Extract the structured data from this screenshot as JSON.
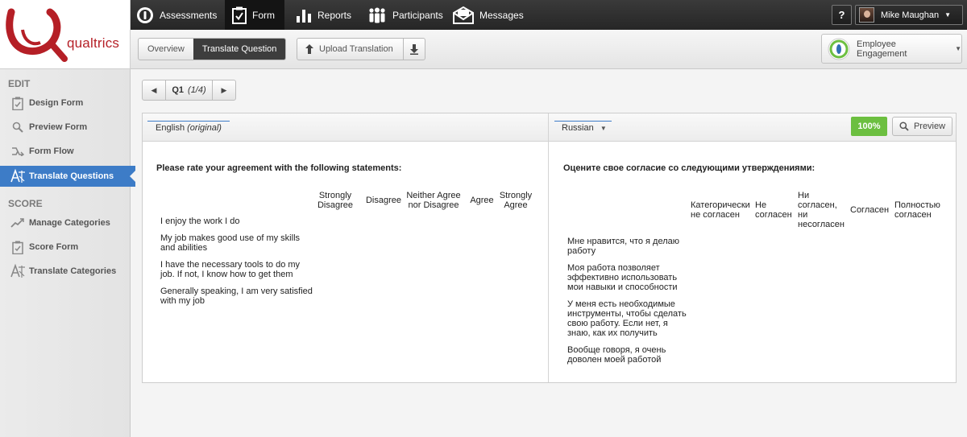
{
  "brand": {
    "logo_text": "qualtrics",
    "color": "#b51f26"
  },
  "topnav": {
    "items": [
      {
        "label": "Assessments",
        "icon": "assessments-icon"
      },
      {
        "label": "Form",
        "icon": "form-icon",
        "active": true
      },
      {
        "label": "Reports",
        "icon": "reports-icon"
      },
      {
        "label": "Participants",
        "icon": "participants-icon"
      },
      {
        "label": "Messages",
        "icon": "messages-icon"
      }
    ],
    "help_label": "?",
    "user_name": "Mike Maughan"
  },
  "toolbar": {
    "tabs": [
      {
        "label": "Overview"
      },
      {
        "label": "Translate Question",
        "active": true
      }
    ],
    "upload_label": "Upload Translation",
    "project_label": "Employee Engagement"
  },
  "sidebar": {
    "edit_title": "EDIT",
    "edit_items": [
      {
        "label": "Design Form",
        "icon": "design-form-icon"
      },
      {
        "label": "Preview Form",
        "icon": "magnifier-icon"
      },
      {
        "label": "Form Flow",
        "icon": "flow-icon"
      },
      {
        "label": "Translate Questions",
        "icon": "translate-icon",
        "active": true
      }
    ],
    "score_title": "SCORE",
    "score_items": [
      {
        "label": "Manage Categories",
        "icon": "trend-icon"
      },
      {
        "label": "Score Form",
        "icon": "score-form-icon"
      },
      {
        "label": "Translate Categories",
        "icon": "translate-icon"
      }
    ]
  },
  "pager": {
    "question": "Q1",
    "position": "(1/4)"
  },
  "source": {
    "language": "English",
    "language_note": "(original)",
    "question": "Please rate your agreement with the following statements:",
    "choices": [
      "Strongly Disagree",
      "Disagree",
      "Neither Agree nor Disagree",
      "Agree",
      "Strongly Agree"
    ],
    "statements": [
      "I enjoy the work I do",
      "My job makes good use of my skills and abilities",
      "I have the necessary tools to do my job. If not, I know how to get them",
      "Generally speaking, I am very satisfied with my job"
    ]
  },
  "target": {
    "language": "Russian",
    "progress_label": "100%",
    "progress": 1.0,
    "preview_label": "Preview",
    "question": "Оцените свое согласие со следующими утверждениями:",
    "choices": [
      "Категорически не согласен",
      "Не согласен",
      "Ни согласен, ни несогласен",
      "Согласен",
      "Полностью согласен"
    ],
    "statements": [
      "Мне нравится, что я делаю работу",
      "Моя работа позволяет эффективно использовать мои навыки и способности",
      "У меня есть необходимые инструменты, чтобы сделать свою работу. Если нет, я знаю, как их получить",
      "Вообще говоря, я очень доволен моей работой"
    ]
  },
  "colors": {
    "accent": "#3d7cc7",
    "progress_green": "#6cbf40",
    "topbar": "#2a2a2a"
  }
}
